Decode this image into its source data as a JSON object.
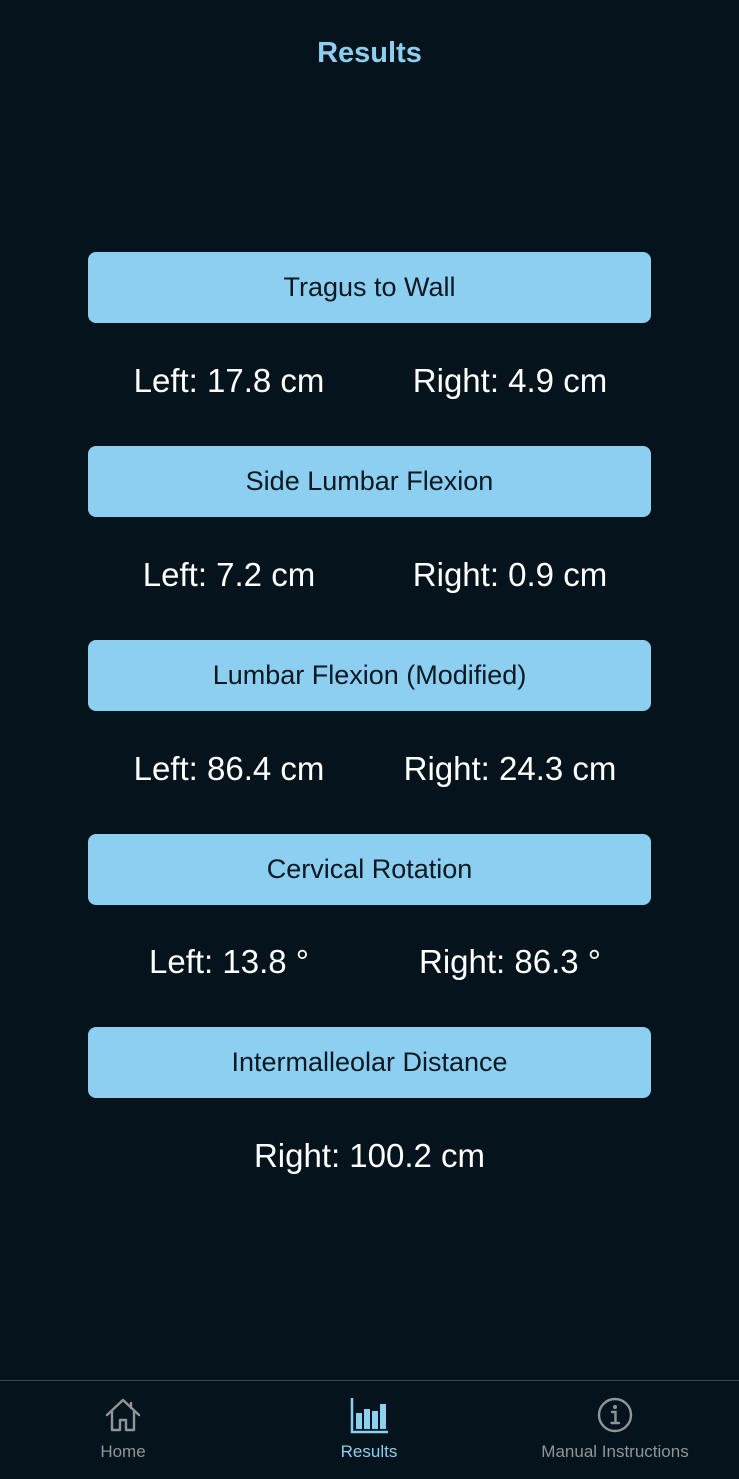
{
  "header": {
    "title": "Results"
  },
  "results": [
    {
      "name": "Tragus to Wall",
      "left": "Left: 17.8 cm",
      "right": "Right: 4.9 cm"
    },
    {
      "name": "Side Lumbar Flexion",
      "left": "Left: 7.2 cm",
      "right": "Right: 0.9 cm"
    },
    {
      "name": "Lumbar Flexion (Modified)",
      "left": "Left: 86.4 cm",
      "right": "Right: 24.3 cm"
    },
    {
      "name": "Cervical Rotation",
      "left": "Left: 13.8 °",
      "right": "Right: 86.3 °"
    },
    {
      "name": "Intermalleolar Distance",
      "right": "Right: 100.2 cm"
    }
  ],
  "tabbar": {
    "tabs": [
      {
        "label": "Home",
        "icon": "home-icon",
        "active": false
      },
      {
        "label": "Results",
        "icon": "bar-chart-icon",
        "active": true
      },
      {
        "label": "Manual Instructions",
        "icon": "info-icon",
        "active": false
      }
    ]
  },
  "colors": {
    "background": "#05141c",
    "accent": "#8ccff0",
    "button_text": "#0a1822",
    "inactive_tab": "#8e959b"
  }
}
